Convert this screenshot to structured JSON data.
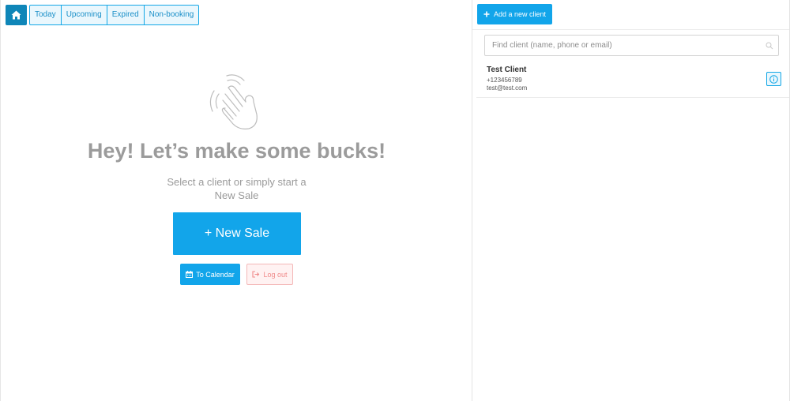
{
  "nav": {
    "home_icon": "home-icon",
    "filters": [
      {
        "label": "Today"
      },
      {
        "label": "Upcoming"
      },
      {
        "label": "Expired"
      },
      {
        "label": "Non-booking"
      }
    ]
  },
  "welcome": {
    "icon": "waving-hand-icon",
    "headline": "Hey! Let’s make some bucks!",
    "subtitle": "Select a client or simply start a New Sale",
    "new_sale_label": "+ New Sale",
    "calendar_label": "To Calendar",
    "logout_label": "Log out"
  },
  "clients": {
    "add_label": "Add a new client",
    "search_placeholder": "Find client (name, phone or email)",
    "items": [
      {
        "name": "Test Client",
        "phone": "+123456789",
        "email": "test@test.com"
      }
    ]
  },
  "colors": {
    "accent": "#12a5ea",
    "home": "#0f86b8",
    "logout": "#f08a8a",
    "heading": "#9b9b9b"
  }
}
